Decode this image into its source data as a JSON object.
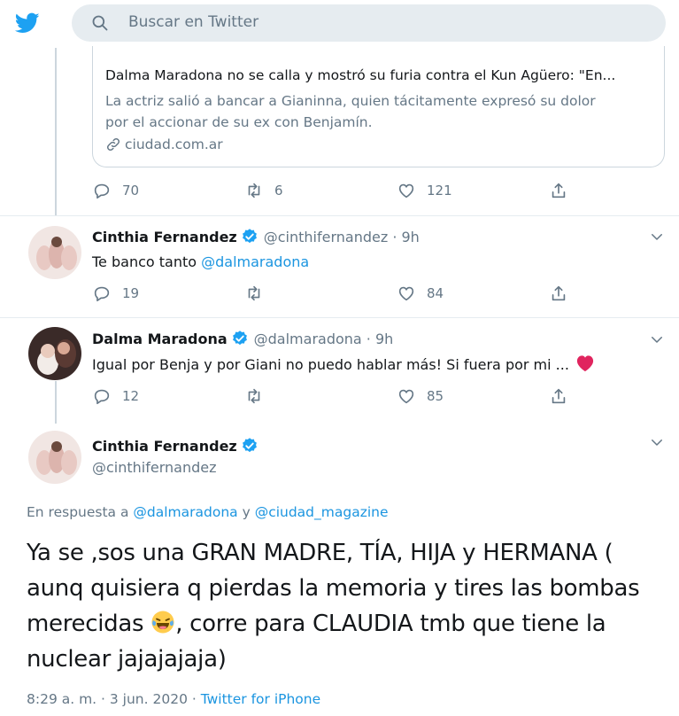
{
  "header": {
    "search_placeholder": "Buscar en Twitter",
    "brand_color": "#1da1f2"
  },
  "card": {
    "title": "Dalma Maradona no se calla y mostró su furia contra el Kun Agüero: \"En...",
    "desc_line1": "La actriz salió a bancar a Gianinna, quien tácitamente expresó su dolor",
    "desc_line2": "por el accionar de su ex con Benjamín.",
    "domain": "ciudad.com.ar"
  },
  "card_actions": {
    "replies": "70",
    "retweets": "6",
    "likes": "121"
  },
  "tweet1": {
    "name": "Cinthia Fernandez",
    "handle": "@cinthifernandez · 9h",
    "text_prefix": "Te banco tanto ",
    "mention": "@dalmaradona",
    "replies": "19",
    "retweets": "",
    "likes": "84"
  },
  "tweet2": {
    "name": "Dalma Maradona",
    "handle": "@dalmaradona · 9h",
    "text": "Igual por Benja y por Giani no puedo hablar más! Si fuera por mi ...",
    "emoji": "heart-emoji",
    "replies": "12",
    "retweets": "",
    "likes": "85"
  },
  "main_tweet": {
    "name": "Cinthia Fernandez",
    "handle": "@cinthifernandez",
    "reply_prefix": "En respuesta a ",
    "reply_mention1": "@dalmaradona",
    "reply_and": " y ",
    "reply_mention2": "@ciudad_magazine",
    "text_line1": "Ya se ,sos una GRAN MADRE, TÍA, HIJA y HERMANA (",
    "text_line2": "aunq quisiera q pierdas la memoria y tires las bombas",
    "text_line3a": "merecidas ",
    "text_line3b": ", corre para CLAUDIA tmb que tiene la",
    "text_line4": "nuclear jajajajaja)",
    "time": "8:29 a. m. · 3 jun. 2020 · ",
    "source": "Twitter for iPhone"
  },
  "colors": {
    "link": "#1b95e0",
    "secondary": "#657786",
    "verified": "#1da1f2",
    "heart": "#e0245e"
  }
}
